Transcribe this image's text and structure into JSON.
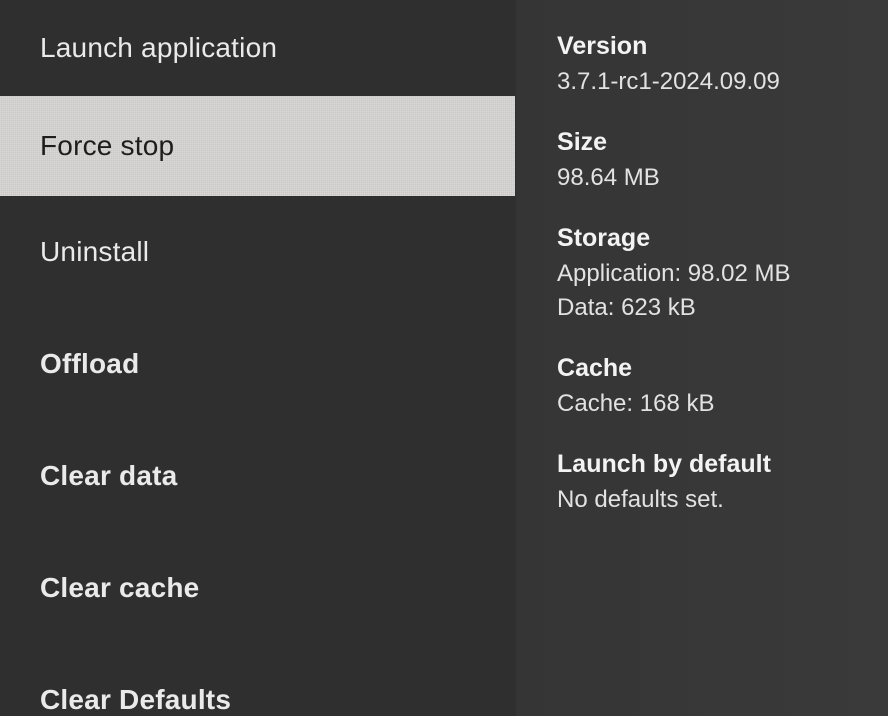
{
  "menu": {
    "items": [
      {
        "label": "Launch application"
      },
      {
        "label": "Force stop"
      },
      {
        "label": "Uninstall"
      },
      {
        "label": "Offload"
      },
      {
        "label": "Clear data"
      },
      {
        "label": "Clear cache"
      },
      {
        "label": "Clear Defaults"
      }
    ],
    "selected_index": 1
  },
  "info": {
    "version": {
      "label": "Version",
      "value": "3.7.1-rc1-2024.09.09"
    },
    "size": {
      "label": "Size",
      "value": "98.64 MB"
    },
    "storage": {
      "label": "Storage",
      "application": "Application: 98.02 MB",
      "data": "Data: 623 kB"
    },
    "cache": {
      "label": "Cache",
      "value": "Cache: 168 kB"
    },
    "launch_default": {
      "label": "Launch by default",
      "value": "No defaults set."
    }
  }
}
